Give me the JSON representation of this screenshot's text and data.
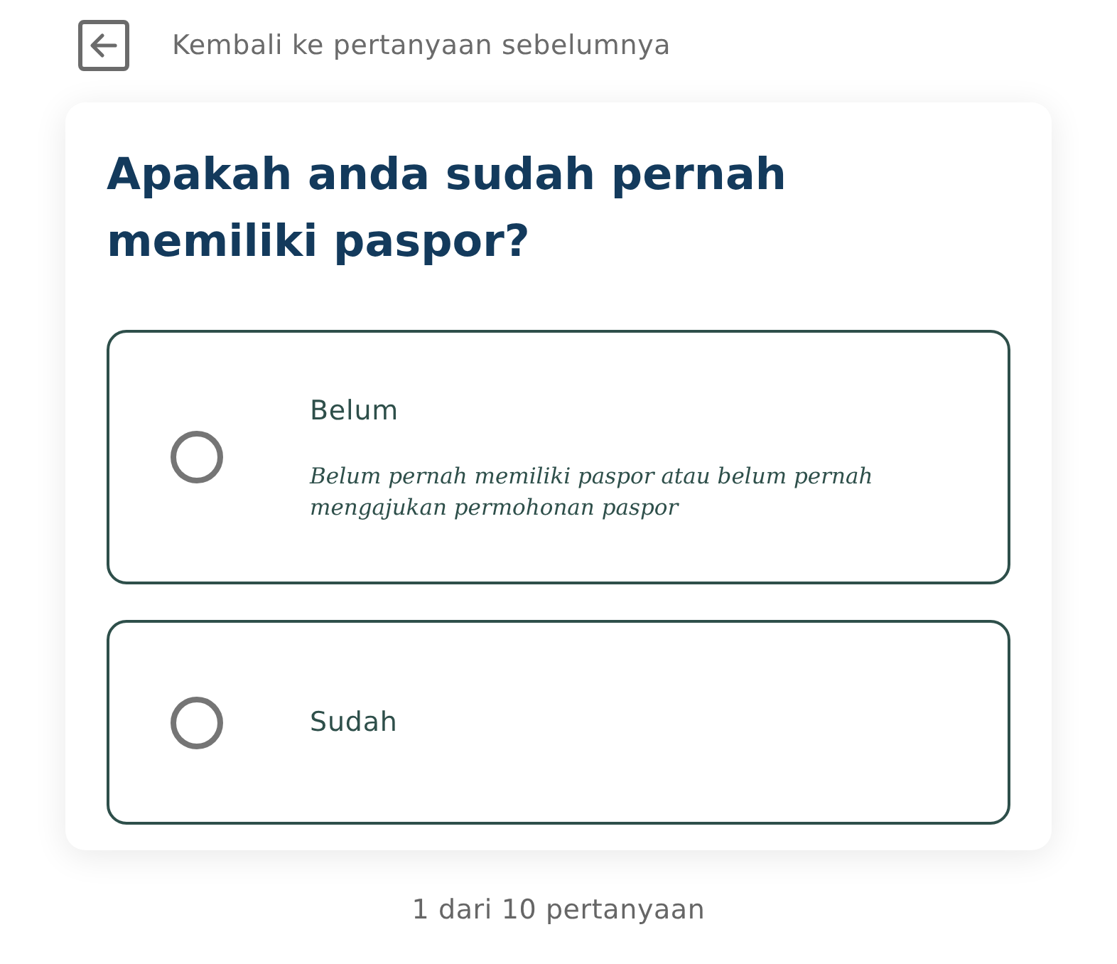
{
  "back_link": {
    "label": "Kembali ke pertanyaan sebelumnya"
  },
  "question": "Apakah anda sudah pernah memiliki paspor?",
  "options": [
    {
      "label": "Belum",
      "description": "Belum pernah memiliki paspor atau belum pernah mengajukan permohonan paspor",
      "selected": false
    },
    {
      "label": "Sudah",
      "selected": false
    }
  ],
  "progress": "1 dari 10 pertanyaan"
}
